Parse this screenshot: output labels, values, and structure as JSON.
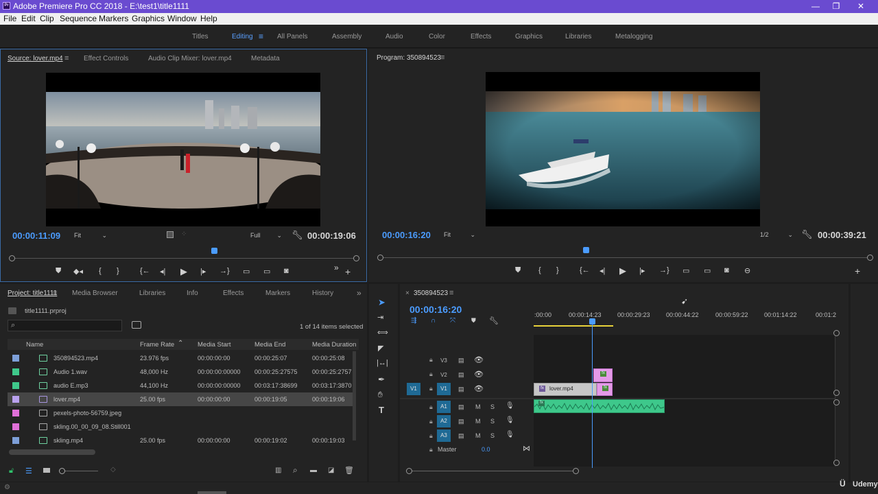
{
  "window": {
    "app_icon": "Pr",
    "title": "Adobe Premiere Pro CC 2018 - E:\\test1\\title1111",
    "minimize": "—",
    "restore": "❐",
    "close": "✕"
  },
  "menu": [
    "File",
    "Edit",
    "Clip",
    "Sequence",
    "Markers",
    "Graphics",
    "Window",
    "Help"
  ],
  "workspaces": {
    "items": [
      "Titles",
      "Editing",
      "All Panels",
      "Assembly",
      "Audio",
      "Color",
      "Effects",
      "Graphics",
      "Libraries",
      "Metalogging"
    ],
    "active": "Editing",
    "menu_icon": "≡"
  },
  "source": {
    "tabs": [
      "Source: lover.mp4",
      "Effect Controls",
      "Audio Clip Mixer: lover.mp4",
      "Metadata"
    ],
    "tab_menu": "≡",
    "timecode": "00:00:11:09",
    "fit": "Fit",
    "resolution": "Full",
    "duration": "00:00:19:06",
    "playhead_fraction": 0.59
  },
  "program": {
    "tab": "Program: 350894523",
    "tab_menu": "≡",
    "timecode": "00:00:16:20",
    "fit": "Fit",
    "resolution": "1/2",
    "duration": "00:00:39:21",
    "playhead_fraction": 0.42
  },
  "transport": {
    "marker": "⛊",
    "in": "{",
    "out": "}",
    "goto_in": "{←",
    "step_back": "◂|",
    "play": "▶",
    "step_fwd": "|▸",
    "goto_out": "→}",
    "insert": "▭",
    "overwrite": "▭",
    "export": "◙",
    "more": "»",
    "add": "+"
  },
  "project": {
    "tabs": [
      "Project: title1111",
      "Media Browser",
      "Libraries",
      "Info",
      "Effects",
      "Markers",
      "History"
    ],
    "more": "»",
    "file": "title1111.prproj",
    "search_placeholder": "",
    "items_selected": "1 of 14 items selected",
    "columns": [
      "Name",
      "Frame Rate",
      "Media Start",
      "Media End",
      "Media Duration"
    ],
    "rows": [
      {
        "color": "#7d9fd8",
        "name": "350894523.mp4",
        "rate": "23.976 fps",
        "start": "00:00:00:00",
        "end": "00:00:25:07",
        "dur": "00:00:25:08",
        "kind": "seq"
      },
      {
        "color": "#3fc98b",
        "name": "Audio 1.wav",
        "rate": "48,000 Hz",
        "start": "00:00:00:00000",
        "end": "00:00:25:27575",
        "dur": "00:00:25:2757",
        "kind": "audio"
      },
      {
        "color": "#3fc98b",
        "name": "audio E.mp3",
        "rate": "44,100 Hz",
        "start": "00:00:00:00000",
        "end": "00:03:17:38699",
        "dur": "00:03:17:3870",
        "kind": "audio"
      },
      {
        "color": "#b9a1ee",
        "name": "lover.mp4",
        "rate": "25.00 fps",
        "start": "00:00:00:00",
        "end": "00:00:19:05",
        "dur": "00:00:19:06",
        "kind": "video",
        "selected": true
      },
      {
        "color": "#e070d8",
        "name": "pexels-photo-56759.jpeg",
        "rate": "",
        "start": "",
        "end": "",
        "dur": "",
        "kind": "image"
      },
      {
        "color": "#e070d8",
        "name": "skling.00_00_09_08.Still001",
        "rate": "",
        "start": "",
        "end": "",
        "dur": "",
        "kind": "image"
      },
      {
        "color": "#7d9fd8",
        "name": "skling.mp4",
        "rate": "25.00 fps",
        "start": "00:00:00:00",
        "end": "00:00:19:02",
        "dur": "00:00:19:03",
        "kind": "seq"
      }
    ]
  },
  "timeline": {
    "tab": "350894523",
    "close": "×",
    "tab_menu": "≡",
    "timecode": "00:00:16:20",
    "ruler": [
      ":00:00",
      "00:00:14:23",
      "00:00:29:23",
      "00:00:44:22",
      "00:00:59:22",
      "00:01:14:22",
      "00:01:2"
    ],
    "video_tracks": [
      "V3",
      "V2",
      "V1"
    ],
    "audio_tracks": [
      "A1",
      "A2",
      "A3"
    ],
    "source_patch_v": "V1",
    "mute": "M",
    "solo": "S",
    "master": "Master",
    "master_value": "0.0",
    "clip_name": "lover.mp4",
    "fx": "fx"
  },
  "tools": [
    "selection",
    "track-select",
    "ripple",
    "razor",
    "slip",
    "pen",
    "hand",
    "type"
  ],
  "footer": {
    "watermark": "Udemy"
  },
  "colors": {
    "accent": "#4b9cff",
    "titlebar": "#6a4bd0",
    "video_clip": "#c0c0c0",
    "audio_clip": "#3ec88b",
    "graphic_clip": "#e49ae8"
  }
}
